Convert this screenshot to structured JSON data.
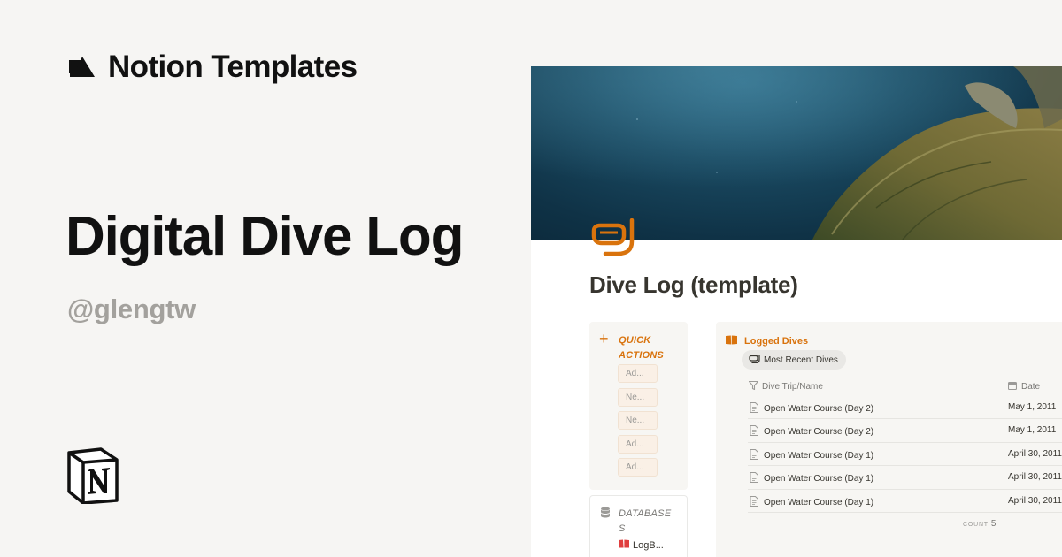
{
  "brand": {
    "name": "Notion Templates",
    "icon": "notion-templates-shapes-icon"
  },
  "hero": {
    "title": "Digital Dive Log",
    "author": "@glengtw"
  },
  "logo": {
    "icon": "notion-logo-icon"
  },
  "preview": {
    "cover": "sea-turtle-underwater-image",
    "page_icon": "snorkel-mask-icon",
    "page_title": "Dive Log (template)",
    "accent_color": "#d9730d",
    "quick_actions": {
      "label": "QUICK ACTIONS",
      "buttons": [
        "Ad...",
        "Ne...",
        "Ne...",
        "Ad...",
        "Ad..."
      ]
    },
    "databases": {
      "label": "DATABASES",
      "link": "LogB..."
    },
    "logged_dives": {
      "title": "Logged Dives",
      "view": "Most Recent Dives",
      "columns": {
        "name": "Dive Trip/Name",
        "date": "Date"
      },
      "rows": [
        {
          "name": "Open Water Course (Day 2)",
          "date": "May 1, 2011"
        },
        {
          "name": "Open Water Course (Day 2)",
          "date": "May 1, 2011"
        },
        {
          "name": "Open Water Course (Day 1)",
          "date": "April 30, 2011"
        },
        {
          "name": "Open Water Course (Day 1)",
          "date": "April 30, 2011"
        },
        {
          "name": "Open Water Course (Day 1)",
          "date": "April 30, 2011"
        }
      ],
      "count_label": "COUNT",
      "count_value": "5"
    }
  }
}
